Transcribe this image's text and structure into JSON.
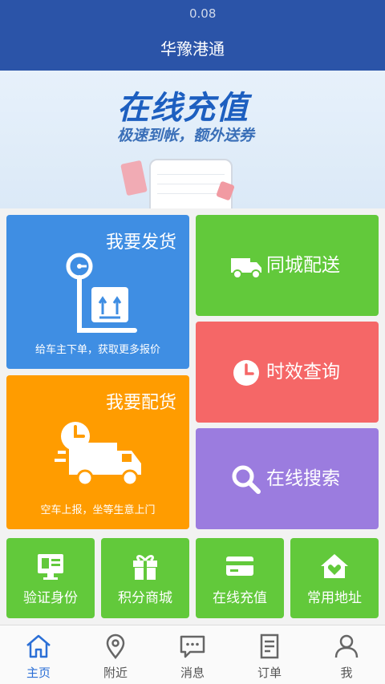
{
  "status_bar": {
    "speed": "0.08"
  },
  "header": {
    "title": "华豫港通"
  },
  "banner": {
    "title": "在线充值",
    "subtitle": "极速到帐，额外送券"
  },
  "tiles": {
    "send": {
      "label": "我要发货",
      "desc": "给车主下单，获取更多报价",
      "color": "#3f8ee3"
    },
    "match": {
      "label": "我要配货",
      "desc": "空车上报，坐等生意上门",
      "color": "#ff9c00"
    },
    "city": {
      "label": "同城配送",
      "color": "#62c93b"
    },
    "time": {
      "label": "时效查询",
      "color": "#f56767"
    },
    "search": {
      "label": "在线搜索",
      "color": "#9b7cdf"
    }
  },
  "quick": [
    {
      "label": "验证身份",
      "icon": "id-card-icon"
    },
    {
      "label": "积分商城",
      "icon": "gift-icon"
    },
    {
      "label": "在线充值",
      "icon": "card-icon"
    },
    {
      "label": "常用地址",
      "icon": "home-heart-icon"
    }
  ],
  "tabs": [
    {
      "label": "主页",
      "icon": "home-icon",
      "active": true
    },
    {
      "label": "附近",
      "icon": "location-pin-icon"
    },
    {
      "label": "消息",
      "icon": "message-icon"
    },
    {
      "label": "订单",
      "icon": "order-icon"
    },
    {
      "label": "我",
      "icon": "user-icon"
    }
  ],
  "colors": {
    "primary": "#2b54a8",
    "active_tab": "#2b6fd6"
  }
}
